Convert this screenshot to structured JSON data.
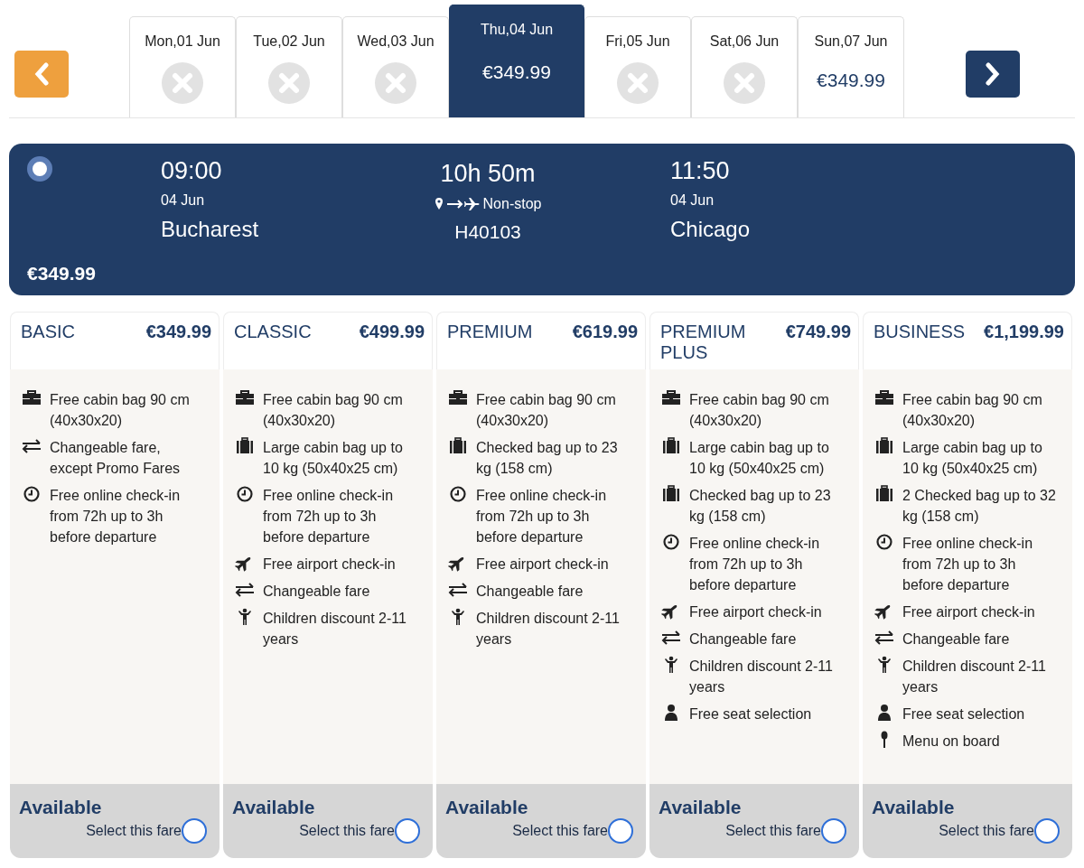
{
  "date_tabs": [
    {
      "label": "Mon,01 Jun",
      "selected": false,
      "available": false
    },
    {
      "label": "Tue,02 Jun",
      "selected": false,
      "available": false
    },
    {
      "label": "Wed,03 Jun",
      "selected": false,
      "available": false
    },
    {
      "label": "Thu,04 Jun",
      "selected": true,
      "available": true,
      "price": "€349.99"
    },
    {
      "label": "Fri,05 Jun",
      "selected": false,
      "available": false
    },
    {
      "label": "Sat,06 Jun",
      "selected": false,
      "available": false
    },
    {
      "label": "Sun,07 Jun",
      "selected": false,
      "available": true,
      "price": "€349.99"
    }
  ],
  "flight": {
    "selected": true,
    "price": "€349.99",
    "departure": {
      "time": "09:00",
      "date": "04 Jun",
      "city": "Bucharest"
    },
    "duration": "10h 50m",
    "stops": "Non-stop",
    "flight_number": "H40103",
    "arrival": {
      "time": "11:50",
      "date": "04 Jun",
      "city": "Chicago"
    }
  },
  "fares": [
    {
      "name": "BASIC",
      "price": "€349.99",
      "status": "Available",
      "select_label": "Select this fare",
      "selected": false,
      "features": [
        {
          "kind": "briefcase",
          "text": "Free cabin bag 90 cm (40x30x20)"
        },
        {
          "kind": "swap",
          "text": "Changeable fare, except Promo Fares"
        },
        {
          "kind": "clock",
          "text": "Free online check-in from 72h up to 3h before departure"
        }
      ]
    },
    {
      "name": "CLASSIC",
      "price": "€499.99",
      "status": "Available",
      "select_label": "Select this fare",
      "selected": false,
      "features": [
        {
          "kind": "briefcase",
          "text": "Free cabin bag 90 cm (40x30x20)"
        },
        {
          "kind": "luggage",
          "text": "Large cabin bag up to 10 kg (50x40x25 cm)"
        },
        {
          "kind": "clock",
          "text": "Free online check-in from 72h up to 3h before departure"
        },
        {
          "kind": "plane",
          "text": "Free airport check-in"
        },
        {
          "kind": "swap",
          "text": "Changeable fare"
        },
        {
          "kind": "child",
          "text": "Children discount 2-11 years"
        }
      ]
    },
    {
      "name": "PREMIUM",
      "price": "€619.99",
      "status": "Available",
      "select_label": "Select this fare",
      "selected": false,
      "features": [
        {
          "kind": "briefcase",
          "text": "Free cabin bag 90 cm (40x30x20)"
        },
        {
          "kind": "luggage",
          "text": "Checked bag up to 23 kg (158 cm)"
        },
        {
          "kind": "clock",
          "text": "Free online check-in from 72h up to 3h before departure"
        },
        {
          "kind": "plane",
          "text": "Free airport check-in"
        },
        {
          "kind": "swap",
          "text": "Changeable fare"
        },
        {
          "kind": "child",
          "text": "Children discount 2-11 years"
        }
      ]
    },
    {
      "name": "PREMIUM PLUS",
      "price": "€749.99",
      "status": "Available",
      "select_label": "Select this fare",
      "selected": false,
      "features": [
        {
          "kind": "briefcase",
          "text": "Free cabin bag 90 cm (40x30x20)"
        },
        {
          "kind": "luggage",
          "text": "Large cabin bag up to 10 kg (50x40x25 cm)"
        },
        {
          "kind": "luggage",
          "text": "Checked bag up to 23 kg (158 cm)"
        },
        {
          "kind": "clock",
          "text": "Free online check-in from 72h up to 3h before departure"
        },
        {
          "kind": "plane",
          "text": "Free airport check-in"
        },
        {
          "kind": "swap",
          "text": "Changeable fare"
        },
        {
          "kind": "child",
          "text": "Children discount 2-11 years"
        },
        {
          "kind": "seat",
          "text": "Free seat selection"
        }
      ]
    },
    {
      "name": "BUSINESS",
      "price": "€1,199.99",
      "status": "Available",
      "select_label": "Select this fare",
      "selected": false,
      "features": [
        {
          "kind": "briefcase",
          "text": "Free cabin bag 90 cm (40x30x20)"
        },
        {
          "kind": "luggage",
          "text": "Large cabin bag up to 10 kg (50x40x25 cm)"
        },
        {
          "kind": "luggage",
          "text": "2 Checked bag up to 32 kg (158 cm)"
        },
        {
          "kind": "clock",
          "text": "Free online check-in from 72h up to 3h before departure"
        },
        {
          "kind": "plane",
          "text": "Free airport check-in"
        },
        {
          "kind": "swap",
          "text": "Changeable fare"
        },
        {
          "kind": "child",
          "text": "Children discount 2-11 years"
        },
        {
          "kind": "seat",
          "text": "Free seat selection"
        },
        {
          "kind": "spoon",
          "text": "Menu on board"
        }
      ]
    }
  ]
}
